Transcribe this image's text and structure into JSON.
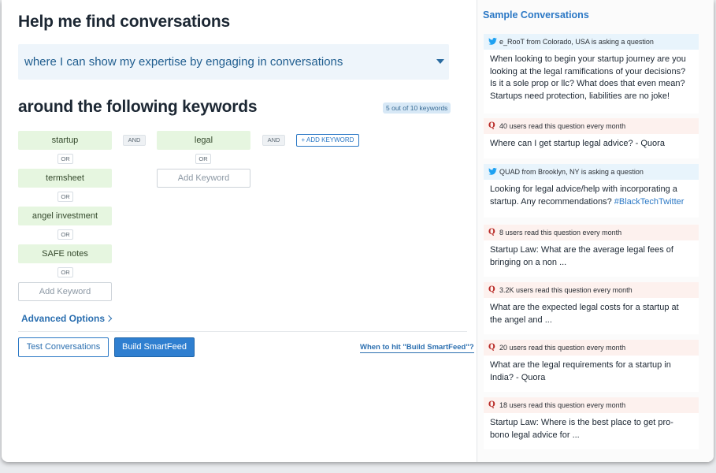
{
  "main": {
    "title": "Help me find conversations",
    "intent": "where I can show my expertise by engaging in conversations",
    "keywords_heading": "around the following keywords",
    "keyword_count": "5 out of 10 keywords",
    "group1": [
      "startup",
      "termsheet",
      "angel investment",
      "SAFE notes"
    ],
    "group2": [
      "legal"
    ],
    "or_label": "OR",
    "and_label": "AND",
    "add_keyword_placeholder": "Add Keyword",
    "add_keyword_button": "+ ADD KEYWORD",
    "advanced_options": "Advanced Options",
    "test_button": "Test Conversations",
    "build_button": "Build SmartFeed",
    "help_link": "When to hit \"Build SmartFeed\"?"
  },
  "sidebar": {
    "title": "Sample Conversations",
    "cards": [
      {
        "source": "twitter",
        "header": "e_RooT from Colorado, USA is asking a question",
        "body": "When looking to begin your startup journey are you looking at the legal ramifications of your decisions? Is it a sole prop or llc? What does that even mean? Startups need protection, liabilities are no joke!"
      },
      {
        "source": "quora",
        "header": "40 users read this question every month",
        "body": "Where can I get startup legal advice? - Quora"
      },
      {
        "source": "twitter",
        "header": "QUAD from Brooklyn, NY is asking a question",
        "body": "Looking for legal advice/help with incorporating a startup. Any recommendations?",
        "hashtag": "#BlackTechTwitter"
      },
      {
        "source": "quora",
        "header": "8 users read this question every month",
        "body": "Startup Law: What are the average legal fees of bringing on a non ..."
      },
      {
        "source": "quora",
        "header": "3.2K users read this question every month",
        "body": "What are the expected legal costs for a startup at the angel and ..."
      },
      {
        "source": "quora",
        "header": "20 users read this question every month",
        "body": "What are the legal requirements for a startup in India? - Quora"
      },
      {
        "source": "quora",
        "header": "18 users read this question every month",
        "body": "Startup Law: Where is the best place to get pro-bono legal advice for ..."
      }
    ]
  },
  "colors": {
    "accent": "#2b78c5",
    "keyword_bg": "#e6f6e0",
    "twitter_bg": "#e8f4fc",
    "quora_bg": "#fdf1ee",
    "quora_red": "#b92b27"
  },
  "icons": {
    "twitter": "twitter-bird-icon",
    "quora": "quora-q-icon",
    "dropdown": "chevron-down-icon",
    "advanced": "chevron-right-icon"
  }
}
